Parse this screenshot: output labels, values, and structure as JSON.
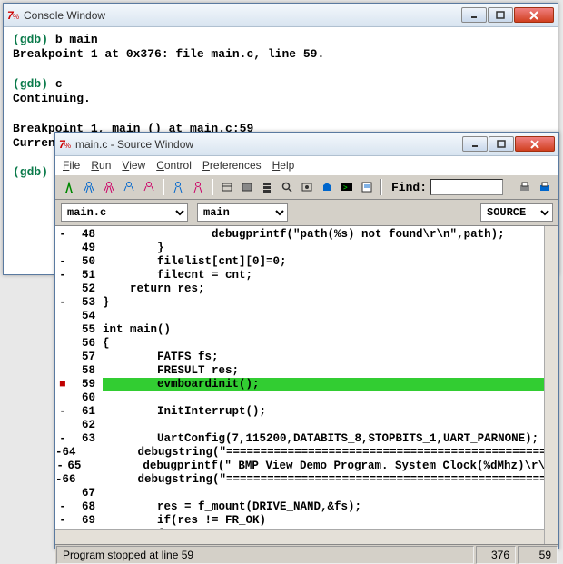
{
  "console": {
    "title": "Console Window",
    "lines": [
      {
        "prompt": "(gdb) ",
        "cmd": "b main"
      },
      {
        "text": "Breakpoint 1 at 0x376: file main.c, line 59."
      },
      {
        "text": ""
      },
      {
        "prompt": "(gdb) ",
        "cmd": "c"
      },
      {
        "text": "Continuing."
      },
      {
        "text": ""
      },
      {
        "text": "Breakpoint 1, main () at main.c:59"
      },
      {
        "text": "Current language:  auto; currently c"
      },
      {
        "text": ""
      },
      {
        "prompt": "(gdb) ",
        "cursor": true
      }
    ]
  },
  "source": {
    "title": "main.c - Source Window",
    "menu": [
      "File",
      "Run",
      "View",
      "Control",
      "Preferences",
      "Help"
    ],
    "find_label": "Find:",
    "find_value": "",
    "file_sel": "main.c",
    "func_sel": "main",
    "mode_sel": "SOURCE",
    "code": [
      {
        "g": "-",
        "n": 48,
        "t": "                debugprintf(\"path(%s) not found\\r\\n\",path);"
      },
      {
        "g": "",
        "n": 49,
        "t": "        }"
      },
      {
        "g": "-",
        "n": 50,
        "t": "        filelist[cnt][0]=0;"
      },
      {
        "g": "-",
        "n": 51,
        "t": "        filecnt = cnt;"
      },
      {
        "g": "",
        "n": 52,
        "t": "    return res;"
      },
      {
        "g": "-",
        "n": 53,
        "t": "}"
      },
      {
        "g": "",
        "n": 54,
        "t": ""
      },
      {
        "g": "",
        "n": 55,
        "t": "int main()"
      },
      {
        "g": "",
        "n": 56,
        "t": "{"
      },
      {
        "g": "",
        "n": 57,
        "t": "        FATFS fs;"
      },
      {
        "g": "",
        "n": 58,
        "t": "        FRESULT res;"
      },
      {
        "g": "bp",
        "n": 59,
        "t": "        evmboardinit();",
        "hl": true
      },
      {
        "g": "",
        "n": 60,
        "t": ""
      },
      {
        "g": "-",
        "n": 61,
        "t": "        InitInterrupt();"
      },
      {
        "g": "",
        "n": 62,
        "t": ""
      },
      {
        "g": "-",
        "n": 63,
        "t": "        UartConfig(7,115200,DATABITS_8,STOPBITS_1,UART_PARNONE);"
      },
      {
        "g": "-",
        "n": 64,
        "t": "        debugstring(\"================================================\""
      },
      {
        "g": "-",
        "n": 65,
        "t": "        debugprintf(\" BMP View Demo Program. System Clock(%dMhz)\\r\\n\""
      },
      {
        "g": "-",
        "n": 66,
        "t": "        debugstring(\"================================================\""
      },
      {
        "g": "",
        "n": 67,
        "t": ""
      },
      {
        "g": "-",
        "n": 68,
        "t": "        res = f_mount(DRIVE_NAND,&fs);"
      },
      {
        "g": "-",
        "n": 69,
        "t": "        if(res != FR_OK)"
      },
      {
        "g": "",
        "n": 70,
        "t": "        {"
      }
    ],
    "status": "Program stopped at line 59",
    "pos_col": "376",
    "pos_line": "59"
  }
}
